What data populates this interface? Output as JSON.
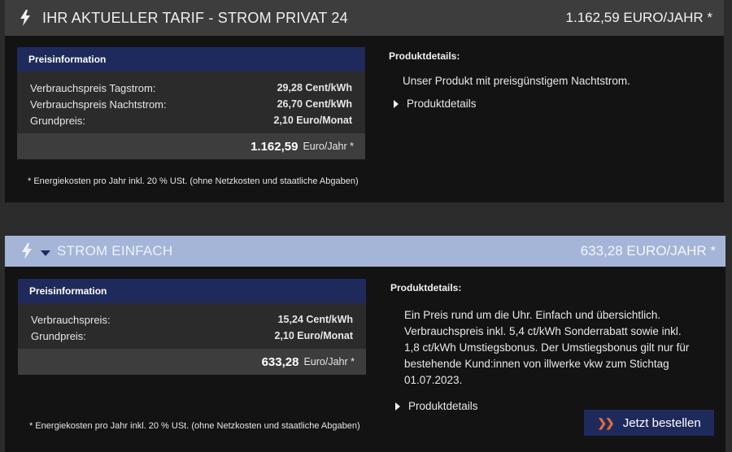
{
  "colors": {
    "header_dark": "#3d3d3d",
    "header_active": "#a4b5d7",
    "navy": "#1f2a5c",
    "accent_orange": "#e06b3b"
  },
  "tariffs": [
    {
      "title": "IHR AKTUELLER TARIF - STROM PRIVAT 24",
      "header_price": "1.162,59 EURO/JAHR *",
      "price_info_title": "Preisinformation",
      "rows": [
        {
          "label": "Verbrauchspreis Tagstrom:",
          "value": "29,28 Cent/kWh"
        },
        {
          "label": "Verbrauchspreis Nachtstrom:",
          "value": "26,70 Cent/kWh"
        },
        {
          "label": "Grundpreis:",
          "value": "2,10 Euro/Monat"
        }
      ],
      "total_value": "1.162,59",
      "total_unit": "Euro/Jahr *",
      "footnote": "* Energiekosten pro Jahr inkl. 20 % USt. (ohne Netzkosten und staatliche Abgaben)",
      "details_title": "Produktdetails:",
      "details_text": "Unser Produkt mit preisgünstigem Nachtstrom.",
      "details_toggle": "Produktdetails"
    },
    {
      "title": "STROM EINFACH",
      "header_price": "633,28 EURO/JAHR *",
      "price_info_title": "Preisinformation",
      "rows": [
        {
          "label": "Verbrauchspreis:",
          "value": "15,24 Cent/kWh"
        },
        {
          "label": "Grundpreis:",
          "value": "2,10 Euro/Monat"
        }
      ],
      "total_value": "633,28",
      "total_unit": "Euro/Jahr *",
      "footnote": "* Energiekosten pro Jahr inkl. 20 % USt. (ohne Netzkosten und staatliche Abgaben)",
      "details_title": "Produktdetails:",
      "details_text_lines": [
        "Ein Preis rund um die Uhr. Einfach und übersichtlich.",
        "Verbrauchspreis inkl. 5,4 ct/kWh Sonderrabatt sowie inkl.",
        "1,8 ct/kWh Umstiegsbonus. Der Umstiegsbonus gilt nur für",
        "bestehende Kund:innen von illwerke vkw zum Stichtag",
        "01.07.2023."
      ],
      "details_toggle": "Produktdetails",
      "order_button": "Jetzt bestellen"
    }
  ],
  "icons": {
    "tariff": "lightning-bolt-icon",
    "expand": "caret-down-icon",
    "toggle": "triangle-right-icon",
    "order": "double-chevron-right-icon"
  }
}
